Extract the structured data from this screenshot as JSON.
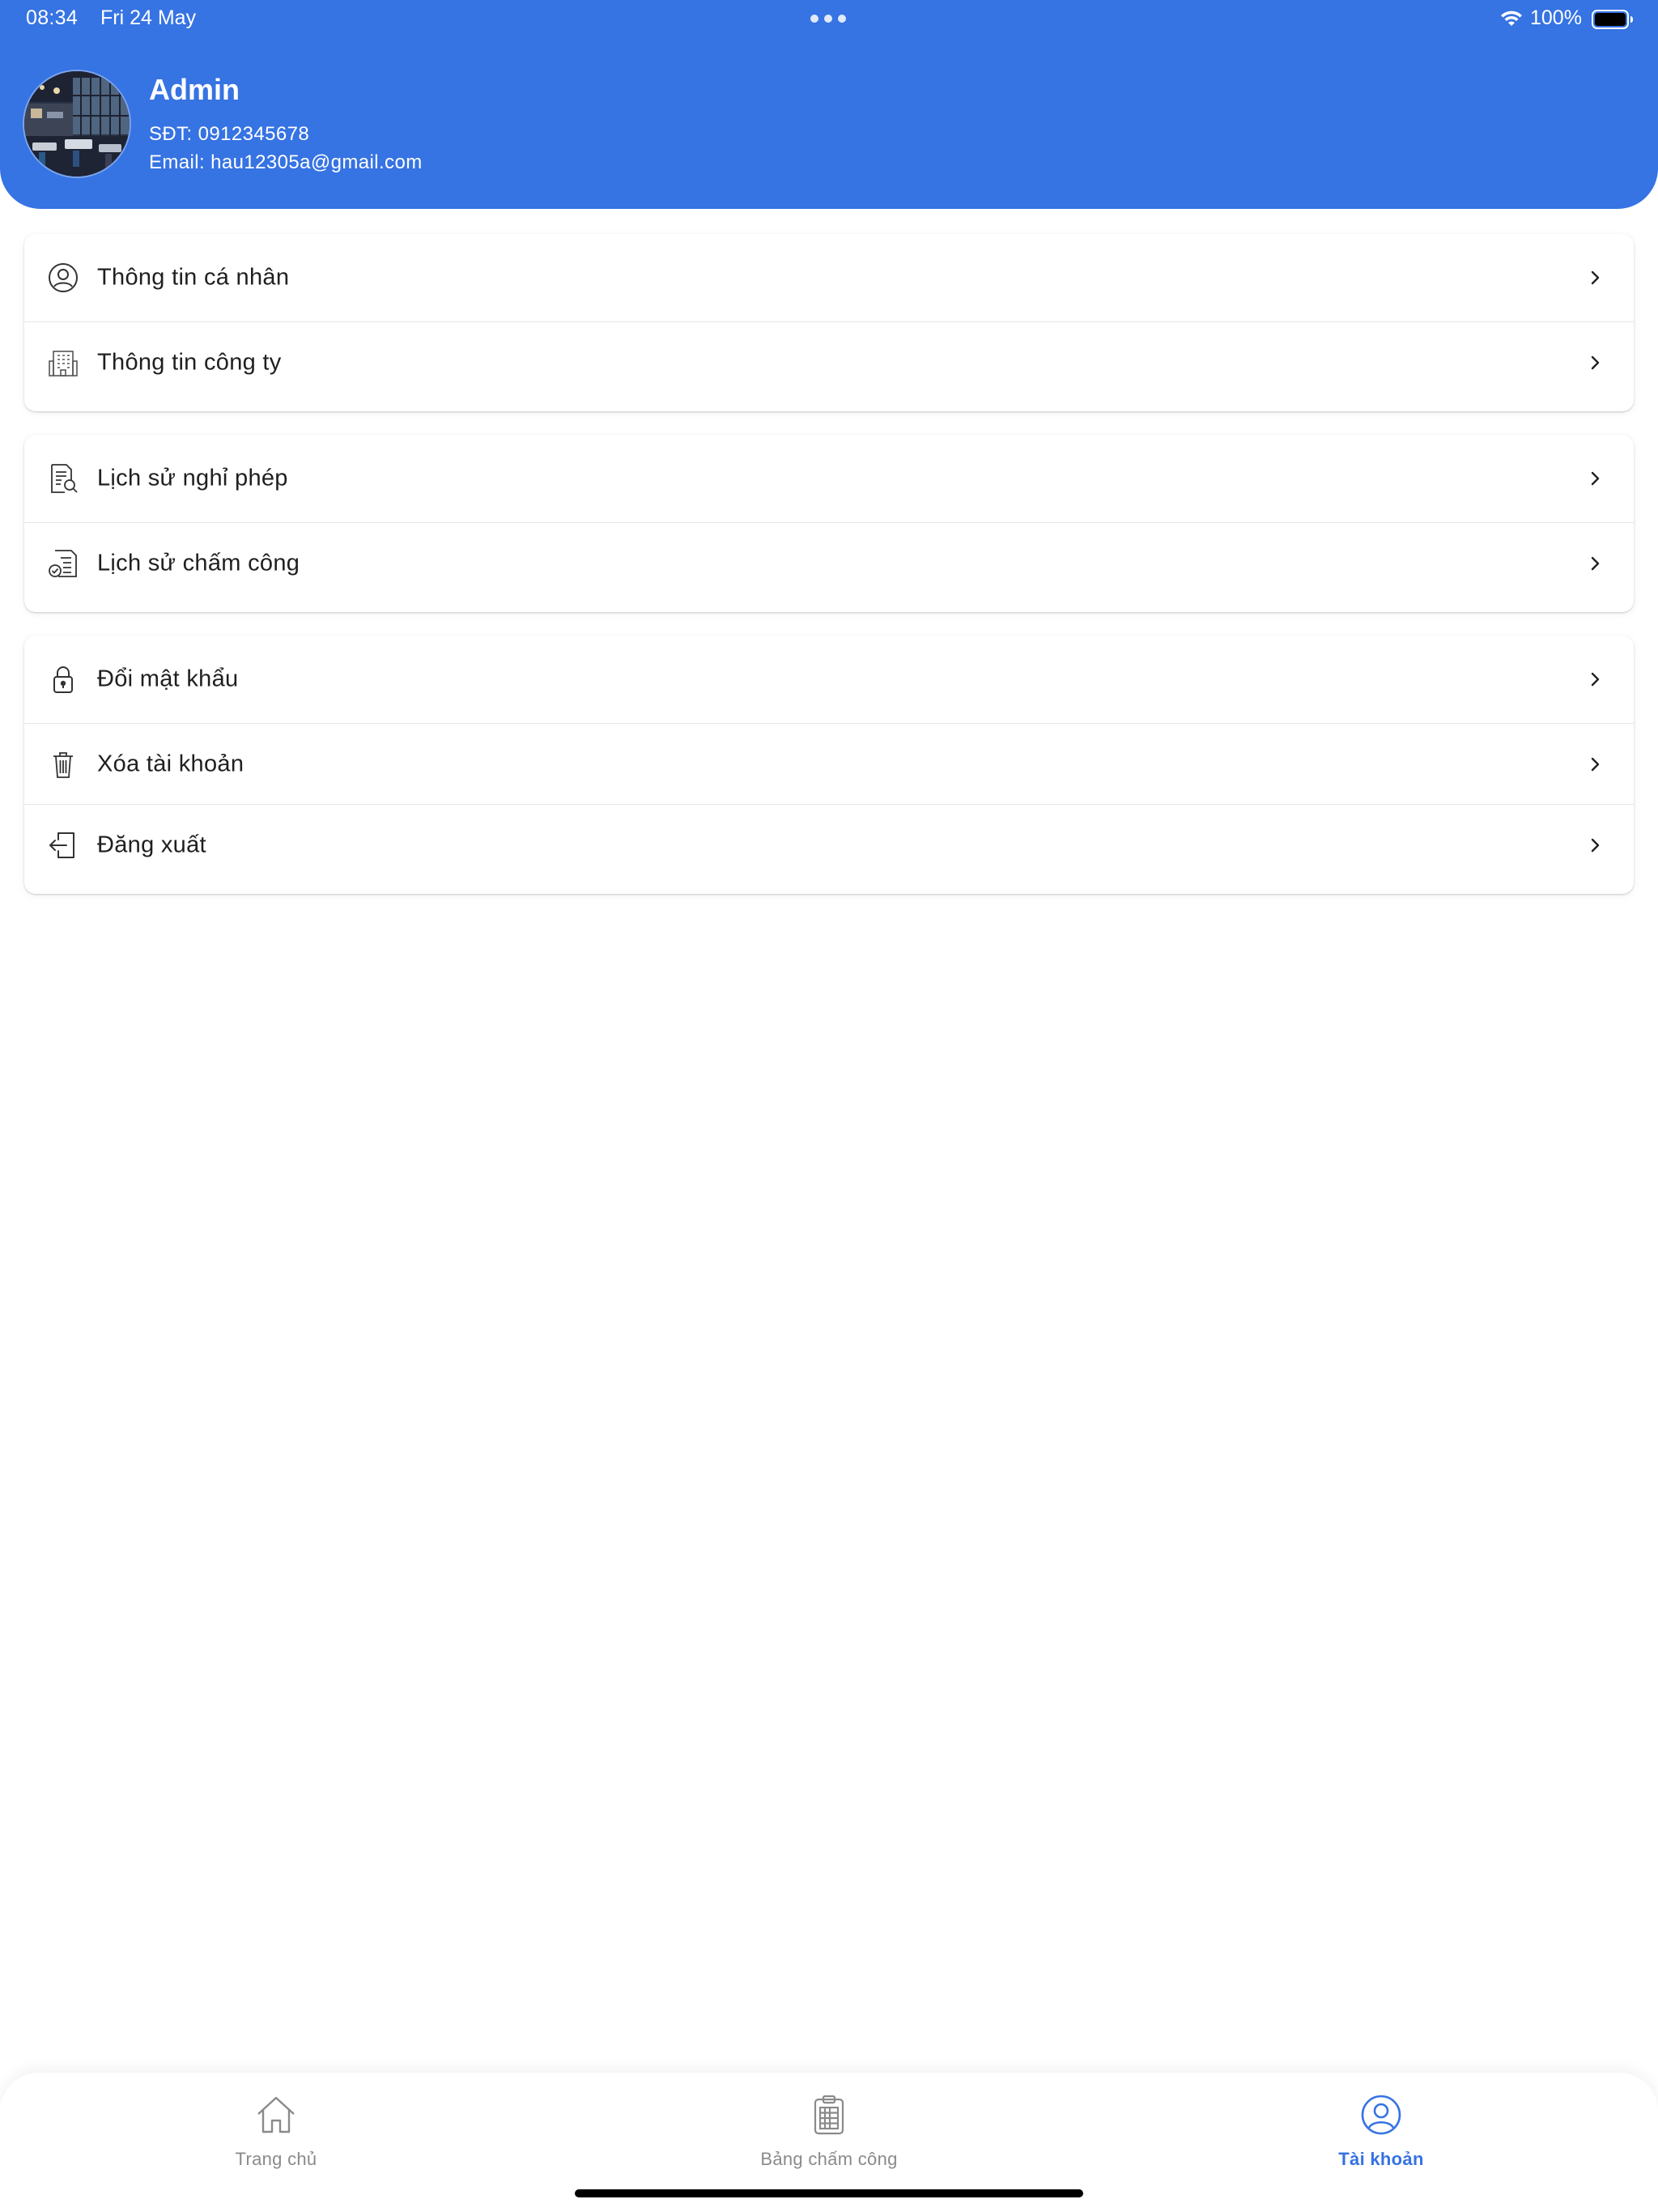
{
  "status_bar": {
    "time": "08:34",
    "date": "Fri 24 May",
    "battery": "100%",
    "icons": [
      "more-dots-icon",
      "wifi-icon",
      "battery-icon"
    ]
  },
  "profile": {
    "name": "Admin",
    "phone": "SĐT: 0912345678",
    "email": "Email: hau12305a@gmail.com",
    "avatar_icon": "restaurant-photo-avatar"
  },
  "menu": {
    "group1": [
      {
        "label": "Thông tin cá nhân",
        "icon": "user-circle-icon"
      },
      {
        "label": "Thông tin công ty",
        "icon": "building-icon"
      }
    ],
    "group2": [
      {
        "label": "Lịch sử nghỉ phép",
        "icon": "document-search-icon"
      },
      {
        "label": "Lịch sử chấm công",
        "icon": "document-check-icon"
      }
    ],
    "group3": [
      {
        "label": "Đổi mật khẩu",
        "icon": "lock-icon"
      },
      {
        "label": "Xóa tài khoản",
        "icon": "trash-icon"
      },
      {
        "label": "Đăng xuất",
        "icon": "logout-icon"
      }
    ],
    "chevron_icon": "chevron-right-icon"
  },
  "tabbar": {
    "tabs": [
      {
        "label": "Trang chủ",
        "icon": "home-icon",
        "active": false
      },
      {
        "label": "Bảng chấm công",
        "icon": "clipboard-icon",
        "active": false
      },
      {
        "label": "Tài khoản",
        "icon": "account-icon",
        "active": true
      }
    ]
  },
  "colors": {
    "primary": "#3673e3",
    "text": "#1f1f1f",
    "inactive_tab": "#8a8a8a",
    "divider": "#e6e6e6",
    "background": "#ffffff"
  }
}
